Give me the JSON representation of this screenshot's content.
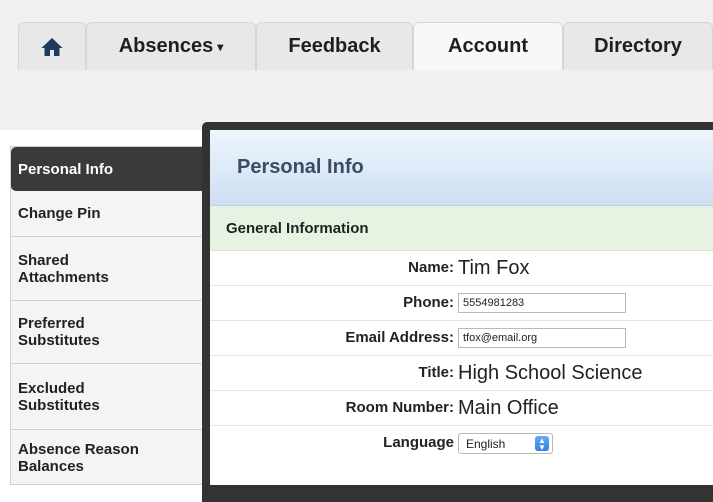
{
  "tabs": {
    "home_icon": "home-icon",
    "absences": "Absences",
    "absences_caret": "▾",
    "feedback": "Feedback",
    "account": "Account",
    "directory": "Directory"
  },
  "sidebar": {
    "items": [
      {
        "label": "Personal Info",
        "active": true
      },
      {
        "label": "Change Pin"
      },
      {
        "label": "Shared Attachments"
      },
      {
        "label": "Preferred Substitutes"
      },
      {
        "label": "Excluded Substitutes"
      },
      {
        "label": "Absence Reason Balances"
      }
    ]
  },
  "panel": {
    "title": "Personal Info",
    "section": "General Information"
  },
  "form": {
    "name_label": "Name:",
    "name_value": "Tim Fox",
    "phone_label": "Phone:",
    "phone_value": "5554981283",
    "email_label": "Email Address:",
    "email_value": "tfox@email.org",
    "title_label": "Title:",
    "title_value": "High School Science",
    "room_label": "Room Number:",
    "room_value": "Main Office",
    "language_label": "Language",
    "language_value": "English"
  },
  "colors": {
    "active_sidebar": "#3a3a3a",
    "panel_header": "#cddff2",
    "section_band": "#e6f3e3",
    "select_accent": "#2f7fe0"
  }
}
